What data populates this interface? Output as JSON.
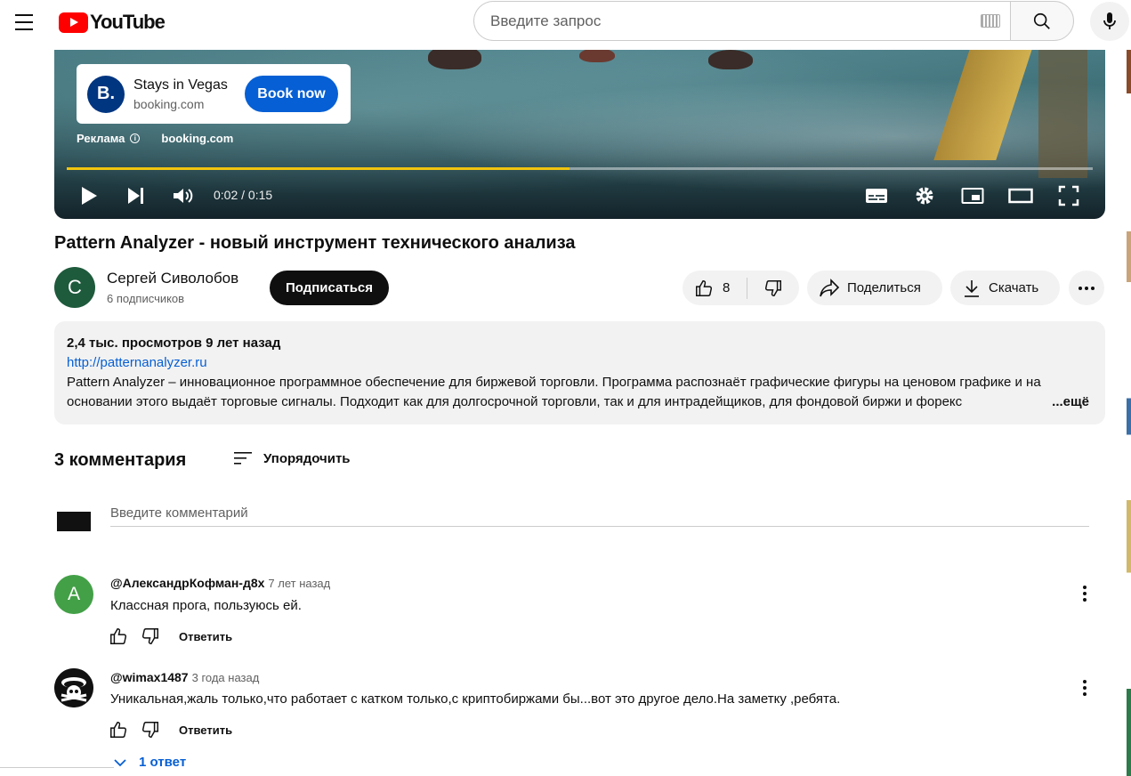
{
  "header": {
    "logo_text": "YouTube",
    "search_placeholder": "Введите запрос"
  },
  "player": {
    "ad": {
      "title": "Stays in Vegas",
      "domain": "booking.com",
      "logo_letter": "B.",
      "cta": "Book now",
      "label": "Реклама",
      "site": "booking.com"
    },
    "time": "0:02 / 0:15",
    "progress_fraction": 0.49
  },
  "video": {
    "title": "Pattern Analyzer - новый инструмент технического анализа",
    "channel": {
      "avatar_letter": "С",
      "name": "Сергей Сиволобов",
      "subscribers": "6 подписчиков"
    },
    "subscribe_label": "Подписаться",
    "likes": "8",
    "share_label": "Поделиться",
    "download_label": "Скачать"
  },
  "description": {
    "meta": "2,4 тыс. просмотров  9 лет назад",
    "link": "http://patternanalyzer.ru",
    "text": "Pattern Analyzer – инновационное программное обеспечение для биржевой торговли. Программа распознаёт графические фигуры на ценовом графике и на основании этого выдаёт торговые сигналы. Подходит как для долгосрочной торговли, так и для интрадейщиков, для фондовой биржи и форекс",
    "more": "...ещё"
  },
  "comments": {
    "count_label": "3 комментария",
    "sort_label": "Упорядочить",
    "input_placeholder": "Введите комментарий",
    "items": [
      {
        "avatar_letter": "А",
        "avatar_color": "#43a047",
        "author": "@АлександрКофман-д8х",
        "time": "7 лет назад",
        "text": "Классная прога, пользуюсь ей.",
        "reply_label": "Ответить"
      },
      {
        "avatar_letter": "",
        "avatar_color": "#111111",
        "author": "@wimax1487",
        "time": "3 года назад",
        "text": "Уникальная,жаль только,что работает с катком только,с криптобиржами бы...вот это другое дело.На заметку ,ребята.",
        "reply_label": "Ответить"
      }
    ],
    "replies_label": "1 ответ"
  },
  "colors": {
    "brand_red": "#ff0000",
    "link_blue": "#065fd4",
    "progress_yellow": "#f1c40f"
  }
}
